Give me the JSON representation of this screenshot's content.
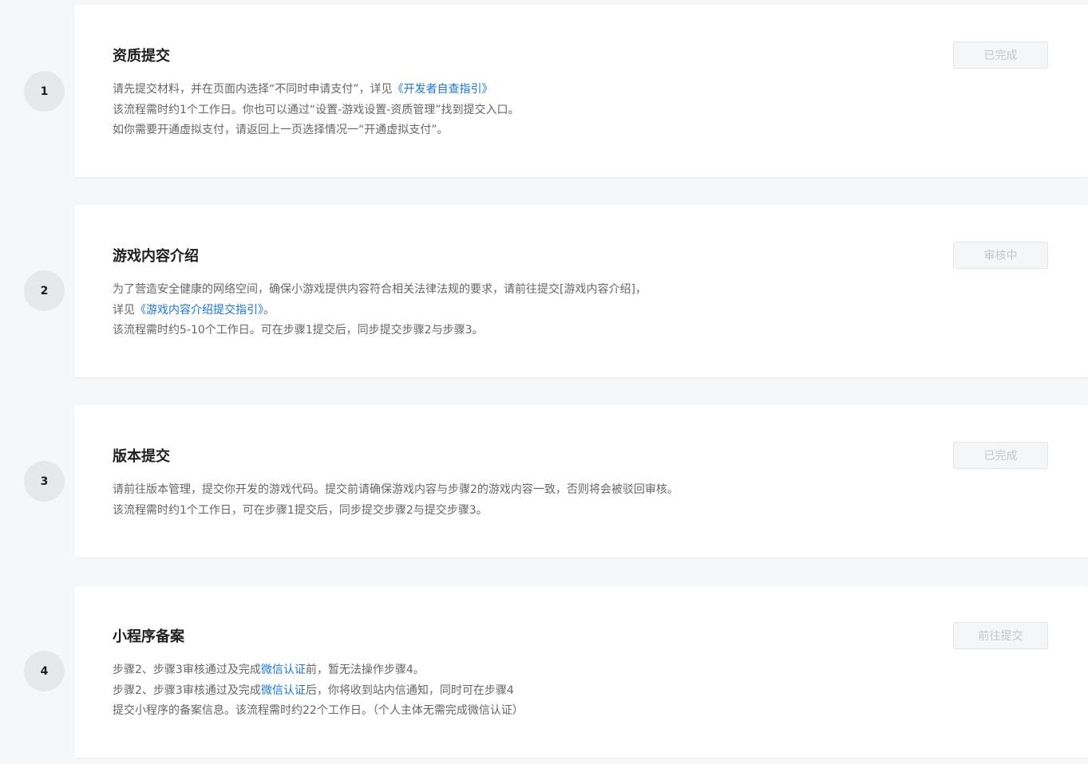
{
  "steps": [
    {
      "number": "1",
      "title": "资质提交",
      "button": "已完成",
      "lines": {
        "l1_a": "请先提交材料，并在页面内选择“不同时申请支付”，详见",
        "l1_link": "《开发者自查指引》",
        "l2": "该流程需时约1个工作日。你也可以通过“设置-游戏设置-资质管理”找到提交入口。",
        "l3": "如你需要开通虚拟支付，请返回上一页选择情况一“开通虚拟支付”。"
      }
    },
    {
      "number": "2",
      "title": "游戏内容介绍",
      "button": "审核中",
      "lines": {
        "l1": "为了营造安全健康的网络空间，确保小游戏提供内容符合相关法律法规的要求，请前往提交[游戏内容介绍]，",
        "l2_a": "详见",
        "l2_link": "《游戏内容介绍提交指引》",
        "l2_b": "。",
        "l3": "该流程需时约5-10个工作日。可在步骤1提交后，同步提交步骤2与步骤3。"
      }
    },
    {
      "number": "3",
      "title": "版本提交",
      "button": "已完成",
      "lines": {
        "l1": "请前往版本管理，提交你开发的游戏代码。提交前请确保游戏内容与步骤2的游戏内容一致，否则将会被驳回审核。",
        "l2": "该流程需时约1个工作日，可在步骤1提交后，同步提交步骤2与提交步骤3。"
      }
    },
    {
      "number": "4",
      "title": "小程序备案",
      "button": "前往提交",
      "lines": {
        "l1_a": "步骤2、步骤3审核通过及完成",
        "l1_link": "微信认证",
        "l1_b": "前，暂无法操作步骤4。",
        "l2_a": "步骤2、步骤3审核通过及完成",
        "l2_link": "微信认证",
        "l2_b": "后，你将收到站内信通知，同时可在步骤4",
        "l3": "提交小程序的备案信息。该流程需时约22个工作日。（个人主体无需完成微信认证）"
      }
    }
  ]
}
